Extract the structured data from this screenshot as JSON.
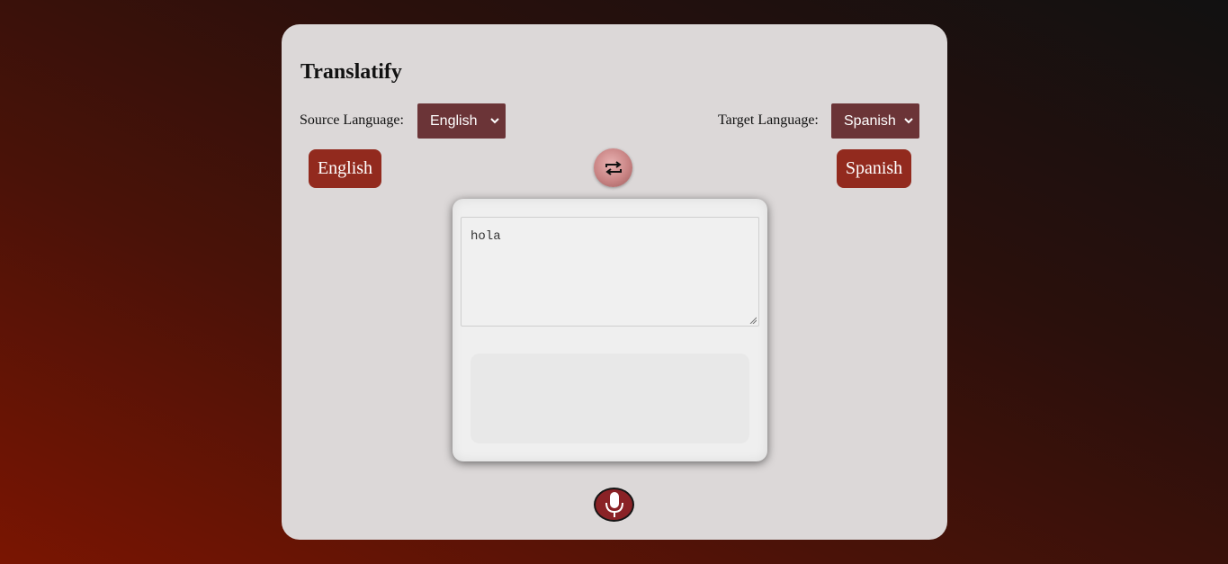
{
  "app": {
    "title": "Translatify"
  },
  "source": {
    "label": "Source Language:",
    "selected": "English",
    "button_label": "English"
  },
  "target": {
    "label": "Target Language:",
    "selected": "Spanish",
    "button_label": "Spanish"
  },
  "input": {
    "value": "hola"
  },
  "output": {
    "value": ""
  },
  "icons": {
    "swap": "swap-arrows-icon",
    "mic": "microphone-icon",
    "dropdown": "chevron-down-icon"
  },
  "colors": {
    "card_bg": "#dcd8d8",
    "select_bg": "#6b3437",
    "lang_button_bg": "#922a1e",
    "mic_bg": "#8a2226",
    "swap_bg": "#c98484"
  }
}
